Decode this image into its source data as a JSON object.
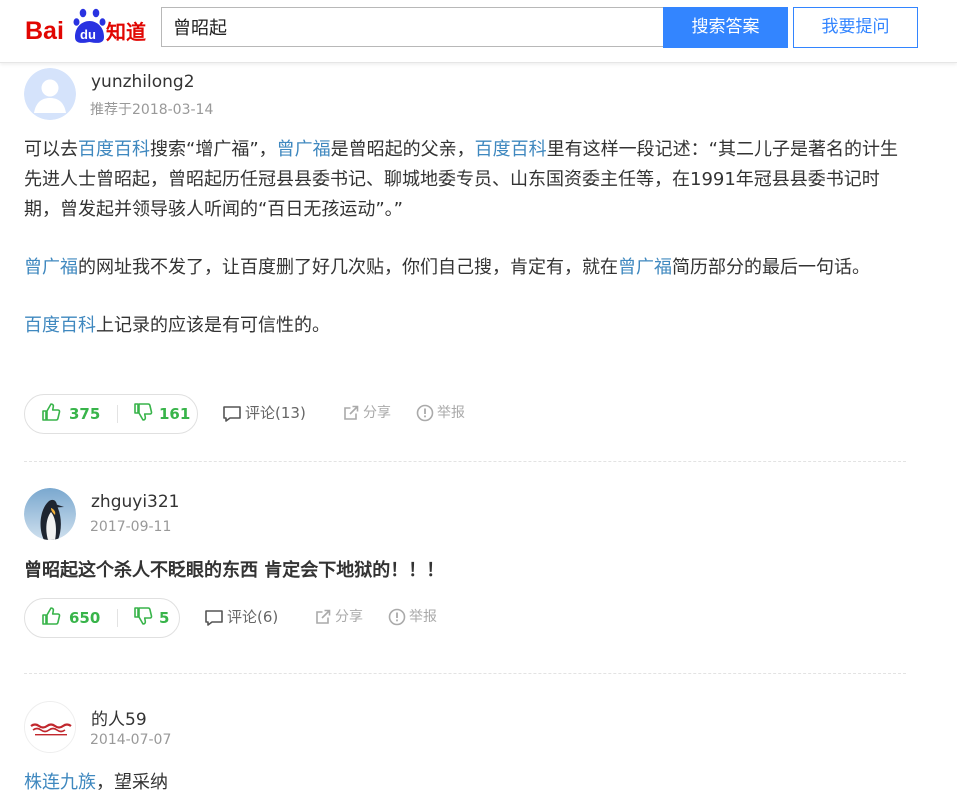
{
  "header": {
    "logo_text": "Bai du 知道",
    "search_value": "曾昭起",
    "search_button": "搜索答案",
    "ask_button": "我要提问"
  },
  "answers": [
    {
      "username": "yunzhilong2",
      "date": "推荐于2018-03-14",
      "body": {
        "p1": {
          "s1": "可以去",
          "l1": "百度百科",
          "s2": "搜索“增广福”，",
          "l2": "曾广福",
          "s3": "是曾昭起的父亲，",
          "l3": "百度百科",
          "s4": "里有这样一段记述：“其二儿子是著名的计生先进人士曾昭起，曾昭起历任冠县县委书记、聊城地委专员、山东国资委主任等，在1991年冠县县委书记时期，曾发起并领导骇人听闻的“百日无孩运动”。”"
        },
        "p2": {
          "l1": "曾广福",
          "s1": "的网址我不发了，让百度删了好几次贴，你们自己搜，肯定有，就在",
          "l2": "曾广福",
          "s2": "简历部分的最后一句话。"
        },
        "p3": {
          "l1": "百度百科",
          "s1": "上记录的应该是有可信性的。"
        }
      },
      "likes": "375",
      "dislikes": "161",
      "comments": "评论(13)",
      "share": "分享",
      "report": "举报"
    },
    {
      "username": "zhguyi321",
      "date": "2017-09-11",
      "body": "曾昭起这个杀人不眨眼的东西 肯定会下地狱的！！！",
      "likes": "650",
      "dislikes": "5",
      "comments": "评论(6)",
      "share": "分享",
      "report": "举报"
    },
    {
      "username": "的人59",
      "date": "2014-07-07",
      "body": {
        "l1": "株连九族",
        "s1": "，望采纳"
      }
    }
  ],
  "icons": [
    "thumbs-up-icon",
    "thumbs-down-icon",
    "comment-icon",
    "share-icon",
    "report-icon"
  ],
  "colors": {
    "accent": "#3385ff",
    "link": "#3f88bf",
    "vote": "#38b44a",
    "baidu_red": "#e10602"
  }
}
